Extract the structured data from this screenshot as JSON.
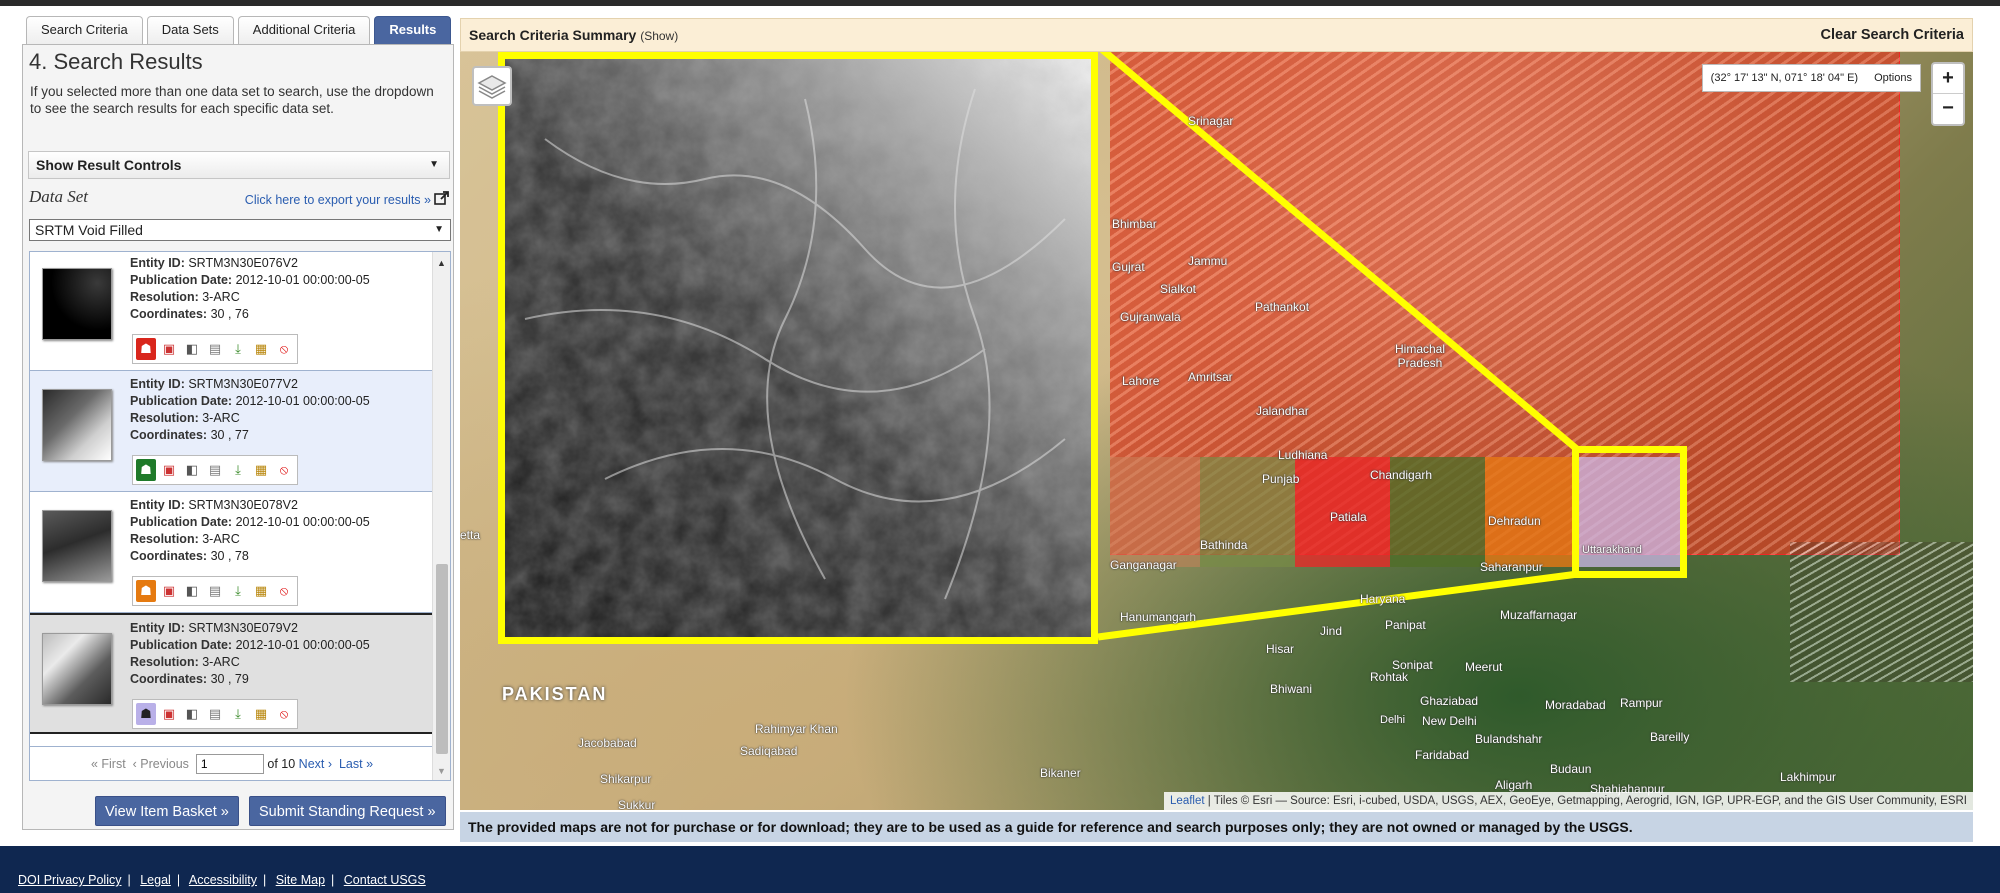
{
  "tabs": [
    {
      "label": "Search Criteria"
    },
    {
      "label": "Data Sets"
    },
    {
      "label": "Additional Criteria"
    },
    {
      "label": "Results"
    }
  ],
  "panel": {
    "title": "4. Search Results",
    "description": "If you selected more than one data set to search, use the dropdown to see the search results for each specific data set.",
    "result_controls": "Show Result Controls",
    "dataset_label": "Data Set",
    "export_link": "Click here to export your results »",
    "dataset_selected": "SRTM Void Filled"
  },
  "results": [
    {
      "entity_label": "Entity ID:",
      "entity_id": "SRTM3N30E076V2",
      "pub_label": "Publication Date:",
      "pub_date": "2012-10-01 00:00:00-05",
      "res_label": "Resolution:",
      "resolution": "3-ARC",
      "coord_label": "Coordinates:",
      "coordinates": "30 , 76"
    },
    {
      "entity_label": "Entity ID:",
      "entity_id": "SRTM3N30E077V2",
      "pub_label": "Publication Date:",
      "pub_date": "2012-10-01 00:00:00-05",
      "res_label": "Resolution:",
      "resolution": "3-ARC",
      "coord_label": "Coordinates:",
      "coordinates": "30 , 77"
    },
    {
      "entity_label": "Entity ID:",
      "entity_id": "SRTM3N30E078V2",
      "pub_label": "Publication Date:",
      "pub_date": "2012-10-01 00:00:00-05",
      "res_label": "Resolution:",
      "resolution": "3-ARC",
      "coord_label": "Coordinates:",
      "coordinates": "30 , 78"
    },
    {
      "entity_label": "Entity ID:",
      "entity_id": "SRTM3N30E079V2",
      "pub_label": "Publication Date:",
      "pub_date": "2012-10-01 00:00:00-05",
      "res_label": "Resolution:",
      "resolution": "3-ARC",
      "coord_label": "Coordinates:",
      "coordinates": "30 , 79"
    }
  ],
  "result_icons": [
    "footprint-icon",
    "overlay-icon",
    "compare-icon",
    "metadata-icon",
    "download-icon",
    "order-icon",
    "exclude-icon"
  ],
  "pager": {
    "first": "« First",
    "previous": "‹ Previous",
    "page": "1",
    "of": "of 10",
    "next": "Next ›",
    "last": "Last »"
  },
  "buttons": {
    "basket": "View Item Basket »",
    "standing": "Submit Standing Request »"
  },
  "criteria": {
    "title": "Search Criteria Summary",
    "show": "(Show)",
    "clear": "Clear Search Criteria"
  },
  "map": {
    "coordinates": "(32° 17' 13\" N, 071° 18' 04\" E)",
    "options": "Options",
    "zoom_in": "+",
    "zoom_out": "−",
    "country": "PAKISTAN",
    "labels": [
      "Srinagar",
      "Bhimbar",
      "Jammu",
      "Gujrat",
      "Sialkot",
      "Gujranwala",
      "Pathankot",
      "Himachal Pradesh",
      "Lahore",
      "Amritsar",
      "Jalandhar",
      "Ludhiana",
      "Punjab",
      "Chandigarh",
      "Patiala",
      "Bathinda",
      "Dehradun",
      "Uttarakhand",
      "Saharanpur",
      "Ganganagar",
      "Hanumangarh",
      "Haryana",
      "Muzaffarnagar",
      "Jind",
      "Panipat",
      "Hisar",
      "Meerut",
      "Rohtak",
      "Sonipat",
      "Bhiwani",
      "Ghaziabad",
      "Moradabad",
      "Rampur",
      "New Delhi",
      "Delhi",
      "Bulandshahr",
      "Bareilly",
      "Faridabad",
      "Aligarh",
      "Budaun",
      "Shahjahanpur",
      "Lakhimpur",
      "Rahimyar Khan",
      "Jacobabad",
      "Sadiqabad",
      "Shikarpur",
      "Sukkur",
      "Bikaner",
      "etta"
    ],
    "attribution_link": "Leaflet",
    "attribution_text": " | Tiles © Esri — Source: Esri, i-cubed, USDA, USGS, AEX, GeoEye, Getmapping, Aerogrid, IGN, IGP, UPR-EGP, and the GIS User Community, ESRI"
  },
  "disclaimer": "The provided maps are not for purchase or for download; they are to be used as a guide for reference and search purposes only; they are not owned or managed by the USGS.",
  "footer": [
    "DOI Privacy Policy",
    "Legal",
    "Accessibility",
    "Site Map",
    "Contact USGS"
  ]
}
